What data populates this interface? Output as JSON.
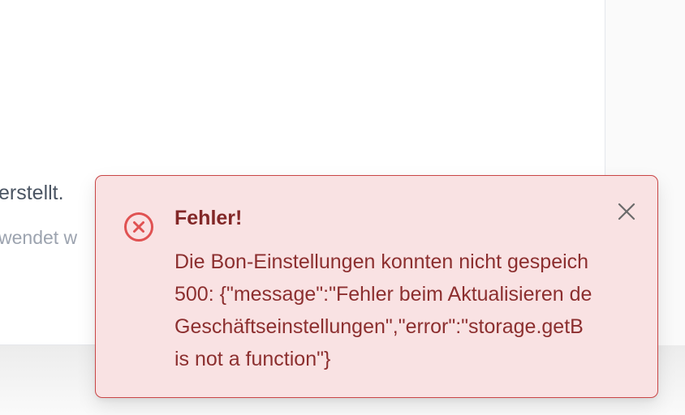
{
  "background": {
    "card_text_main": "erstellt.",
    "card_text_sub": "wendet w"
  },
  "toast": {
    "type": "error",
    "title": "Fehler!",
    "lines": [
      "Die Bon-Einstellungen konnten nicht gespeich",
      "500: {\"message\":\"Fehler beim Aktualisieren de",
      "Geschäftseinstellungen\",\"error\":\"storage.getB",
      "is not a function\"}"
    ],
    "icon": "error-circle-x-icon",
    "close_icon": "close-icon",
    "colors": {
      "background": "#f9e2e3",
      "border": "#c94545",
      "title": "#822727",
      "text": "#8c2f2f",
      "icon": "#e05252",
      "close": "#6b6b6b"
    }
  }
}
